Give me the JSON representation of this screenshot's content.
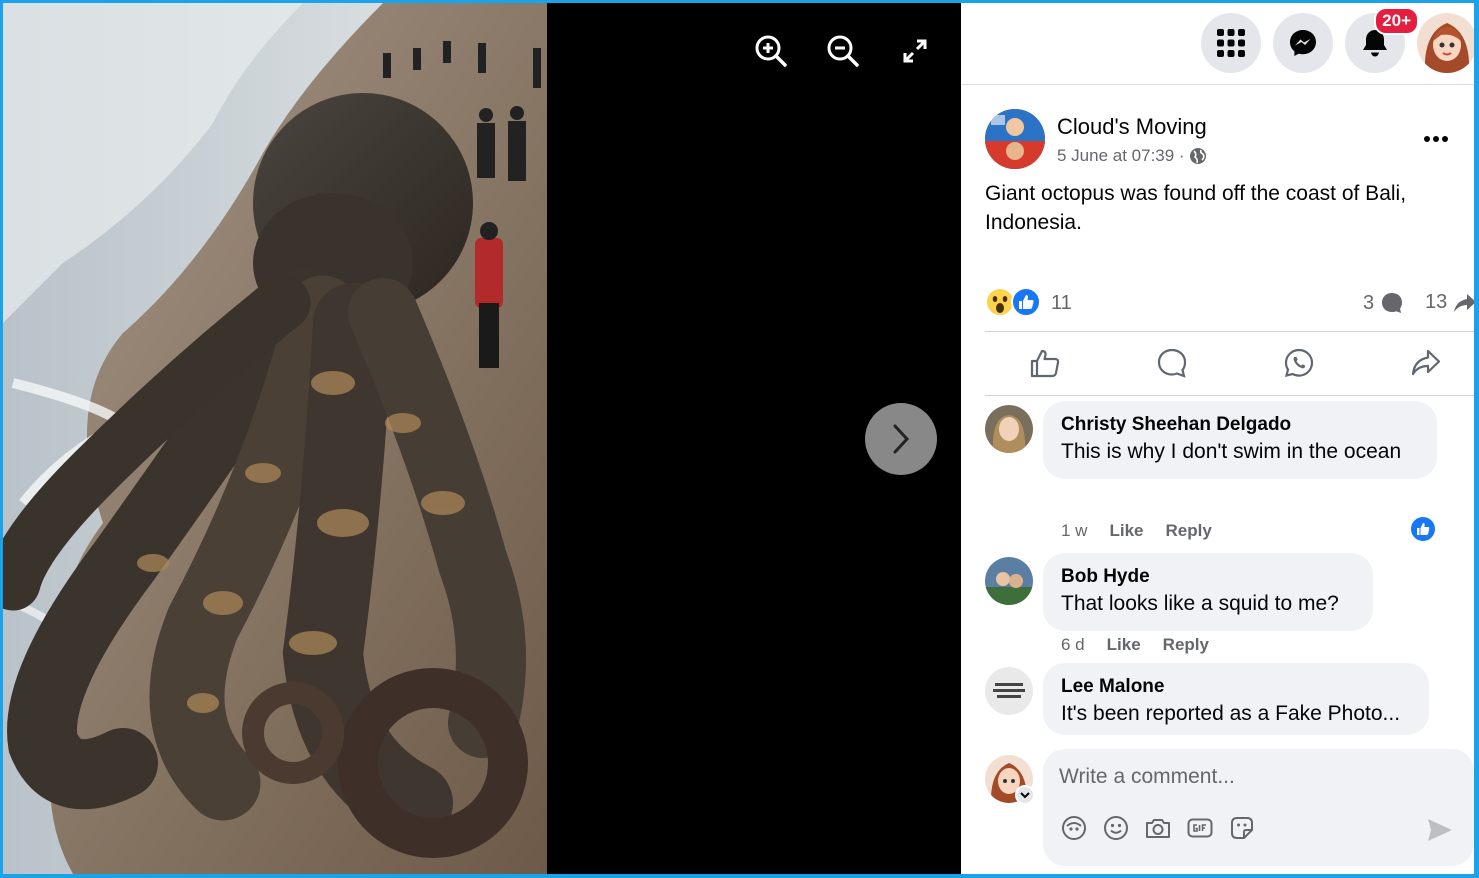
{
  "photo": {
    "alt": "Giant octopus on beach"
  },
  "viewer": {
    "zoom_in_icon": "zoom-in-icon",
    "zoom_out_icon": "zoom-out-icon",
    "fullscreen_icon": "expand-icon",
    "next_icon": "chevron-right-icon"
  },
  "topnav": {
    "menu_icon": "grid-menu-icon",
    "messenger_icon": "messenger-icon",
    "notifications_icon": "bell-icon",
    "notifications_badge": "20+",
    "accent": "#1877f2",
    "badge_color": "#e41e3f"
  },
  "post": {
    "page_name": "Cloud's Moving",
    "date": "5 June at 07:39 ·",
    "text": "Giant octopus was found off the coast of Bali, Indonesia.",
    "reaction_count": "11",
    "comment_count": "3",
    "share_count": "13"
  },
  "comments": [
    {
      "author": "Christy Sheehan Delgado",
      "text": "This is why I don't swim in the ocean",
      "age": "1 w",
      "like_label": "Like",
      "reply_label": "Reply"
    },
    {
      "author": "Bob Hyde",
      "text": "That looks like a squid to me?",
      "age": "6 d",
      "like_label": "Like",
      "reply_label": "Reply"
    },
    {
      "author": "Lee Malone",
      "text": "It's been reported as a Fake Photo..."
    }
  ],
  "composer": {
    "placeholder": "Write a comment..."
  }
}
